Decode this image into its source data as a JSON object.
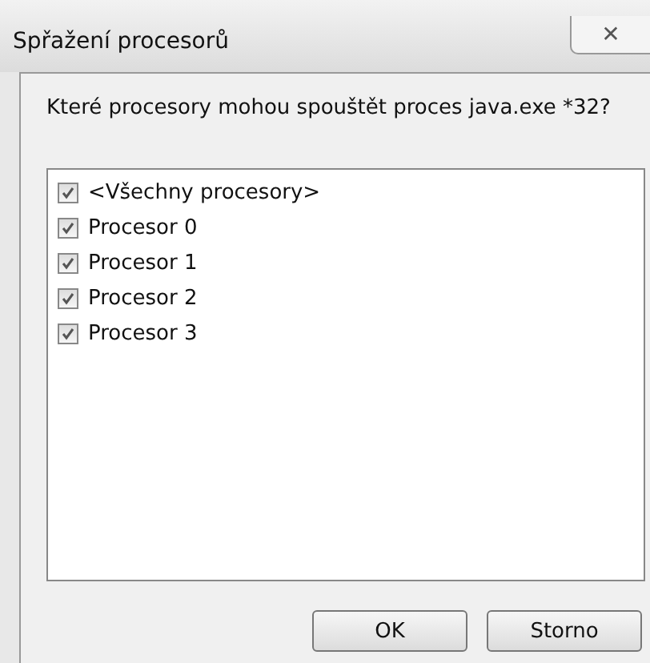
{
  "window": {
    "title": "Spřažení procesorů",
    "close": "✕"
  },
  "question": "Které procesory mohou spouštět proces java.exe *32?",
  "processors": [
    {
      "label": "<Všechny procesory>",
      "checked": true
    },
    {
      "label": "Procesor 0",
      "checked": true
    },
    {
      "label": "Procesor 1",
      "checked": true
    },
    {
      "label": "Procesor 2",
      "checked": true
    },
    {
      "label": "Procesor 3",
      "checked": true
    }
  ],
  "buttons": [
    "OK",
    "Storno"
  ]
}
